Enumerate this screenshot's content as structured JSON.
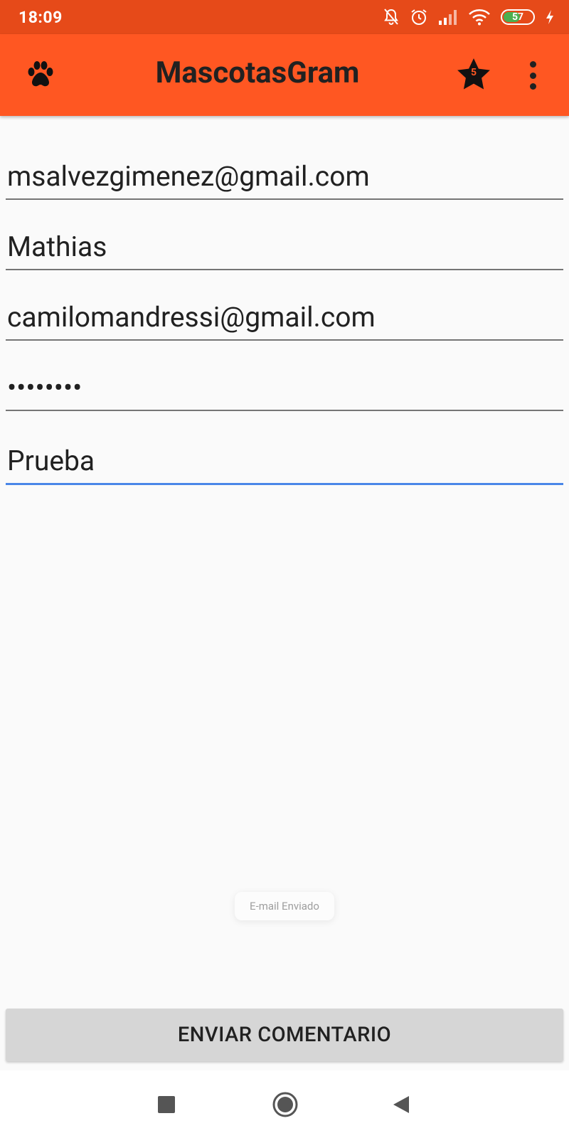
{
  "status_bar": {
    "time": "18:09",
    "battery_percent": "57",
    "battery_level": 0.57,
    "icons": [
      "notifications-off-icon",
      "alarm-icon",
      "signal-icon",
      "wifi-icon",
      "battery-icon",
      "charging-icon"
    ]
  },
  "app_bar": {
    "title": "MascotasGram",
    "icon": "paw-icon",
    "favorites_count": "5",
    "favorites_icon": "star-icon",
    "menu_icon": "more-vert-icon"
  },
  "form": {
    "fields": [
      {
        "value": "msalvezgimenez@gmail.com"
      },
      {
        "value": "Mathias"
      },
      {
        "value": "camilomandressi@gmail.com"
      },
      {
        "value": "••••••••"
      },
      {
        "value": "Prueba"
      }
    ]
  },
  "toast": {
    "text": "E-mail Enviado"
  },
  "send_button": {
    "label": "ENVIAR COMENTARIO"
  },
  "nav_bar": {
    "icons": [
      "recents-icon",
      "home-icon",
      "back-icon"
    ]
  },
  "colors": {
    "status_bar": "#e64a19",
    "app_bar": "#ff5722",
    "active_underline": "#4a86e8",
    "battery_fill": "#4caf50"
  }
}
